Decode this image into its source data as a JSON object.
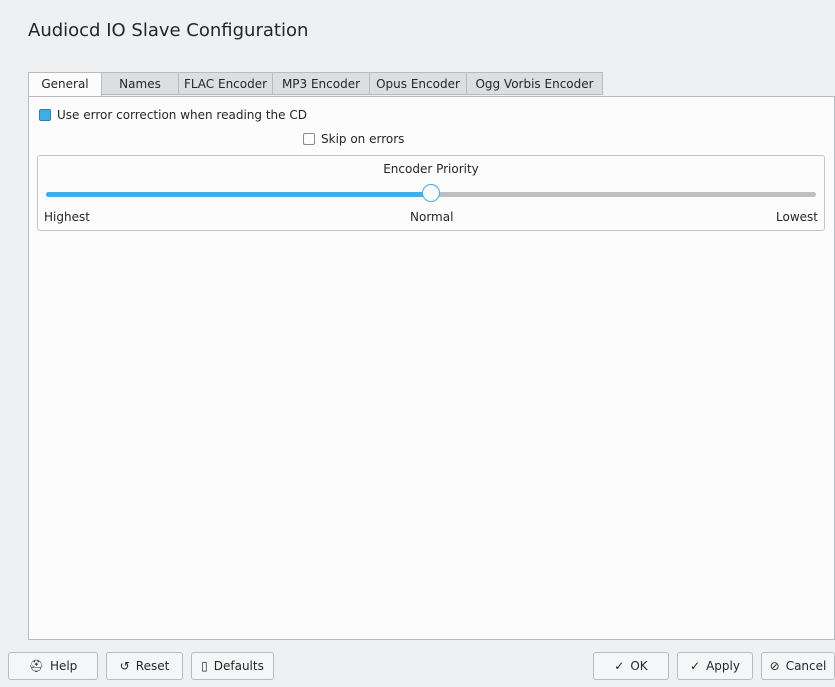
{
  "window": {
    "title": "Audiocd IO Slave Configuration"
  },
  "tabs": [
    {
      "label": "General",
      "active": true
    },
    {
      "label": "Names",
      "active": false
    },
    {
      "label": "FLAC Encoder",
      "active": false
    },
    {
      "label": "MP3 Encoder",
      "active": false
    },
    {
      "label": "Opus Encoder",
      "active": false
    },
    {
      "label": "Ogg Vorbis Encoder",
      "active": false
    }
  ],
  "general": {
    "error_correction": {
      "label": "Use error correction when reading the CD",
      "checked": true
    },
    "skip_on_errors": {
      "label": "Skip on errors",
      "checked": false
    },
    "encoder_priority": {
      "title": "Encoder Priority",
      "min_label": "Highest",
      "mid_label": "Normal",
      "max_label": "Lowest",
      "value_fraction": 0.5
    }
  },
  "buttons": {
    "help": {
      "label": "Help",
      "icon": "help-icon"
    },
    "reset": {
      "label": "Reset",
      "icon": "reset-icon"
    },
    "defaults": {
      "label": "Defaults",
      "icon": "defaults-icon"
    },
    "ok": {
      "label": "OK",
      "icon": "check-icon"
    },
    "apply": {
      "label": "Apply",
      "icon": "check-icon"
    },
    "cancel": {
      "label": "Cancel",
      "icon": "cancel-icon"
    }
  },
  "colors": {
    "accent": "#3daee9",
    "background": "#eff0f1",
    "panel": "#fcfcfc"
  }
}
